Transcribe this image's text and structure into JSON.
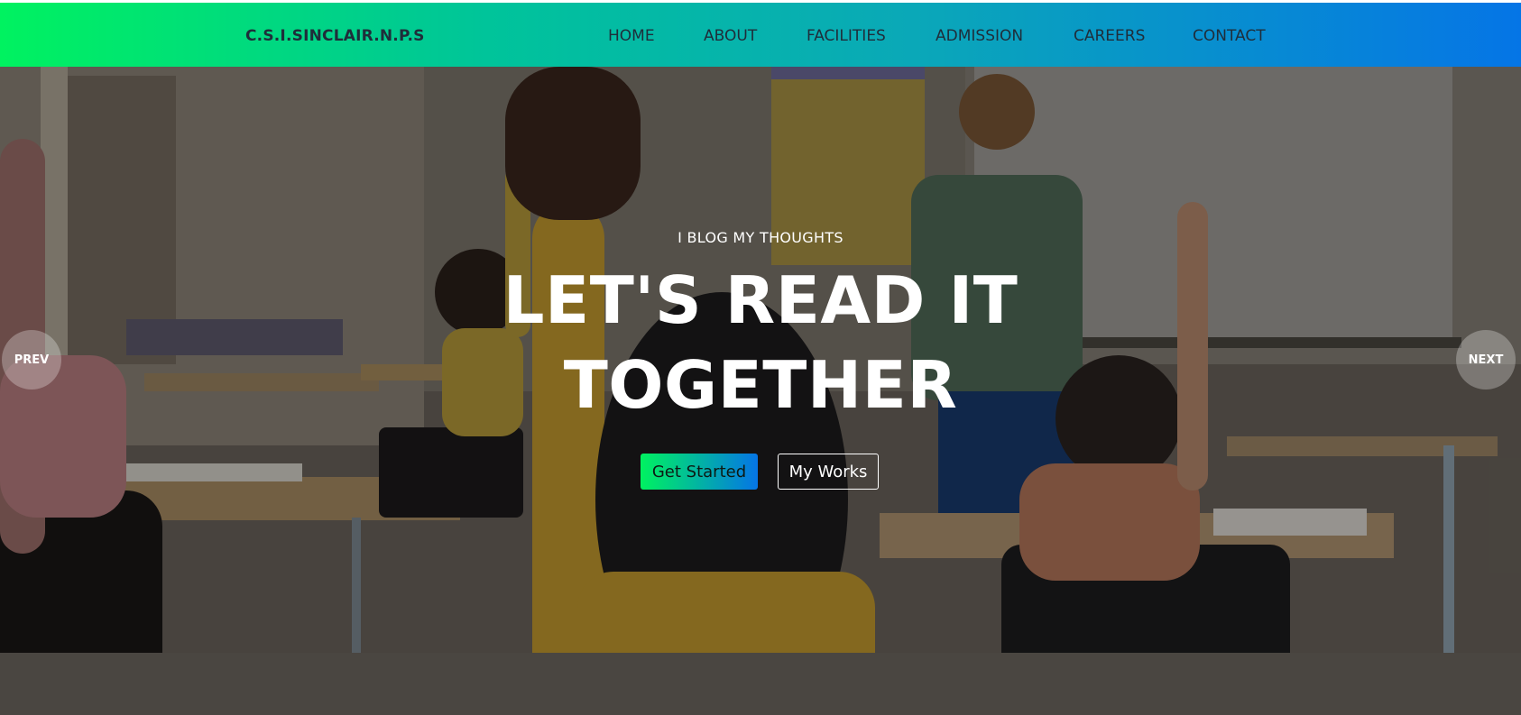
{
  "header": {
    "brand": "C.S.I.SINCLAIR.N.P.S",
    "nav": [
      "HOME",
      "ABOUT",
      "FACILITIES",
      "ADMISSION",
      "CAREERS",
      "CONTACT"
    ]
  },
  "hero": {
    "eyebrow": "I BLOG MY THOUGHTS",
    "headline_line1": "LET'S READ IT",
    "headline_line2": "TOGETHER",
    "primary_button": "Get Started",
    "secondary_button": "My Works",
    "prev_label": "PREV",
    "next_label": "NEXT",
    "background_image": "classroom-photo"
  },
  "colors": {
    "header_gradient_start": "#00f260",
    "header_gradient_end": "#0575e6",
    "nav_text": "#1f2d3a",
    "hero_text": "#ffffff"
  }
}
